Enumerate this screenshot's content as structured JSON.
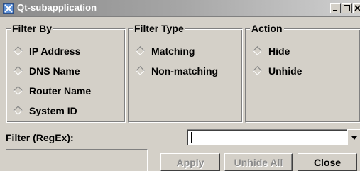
{
  "window": {
    "title": "Qt-subapplication",
    "icon": "app-icon"
  },
  "groups": [
    {
      "title": "Filter By",
      "options": [
        "IP Address",
        "DNS Name",
        "Router Name",
        "System ID"
      ]
    },
    {
      "title": "Filter Type",
      "options": [
        "Matching",
        "Non-matching"
      ]
    },
    {
      "title": "Action",
      "options": [
        "Hide",
        "Unhide"
      ]
    }
  ],
  "filter": {
    "label": "Filter (RegEx):",
    "value": ""
  },
  "buttons": {
    "apply": "Apply",
    "unhide_all": "Unhide All",
    "close": "Close"
  }
}
